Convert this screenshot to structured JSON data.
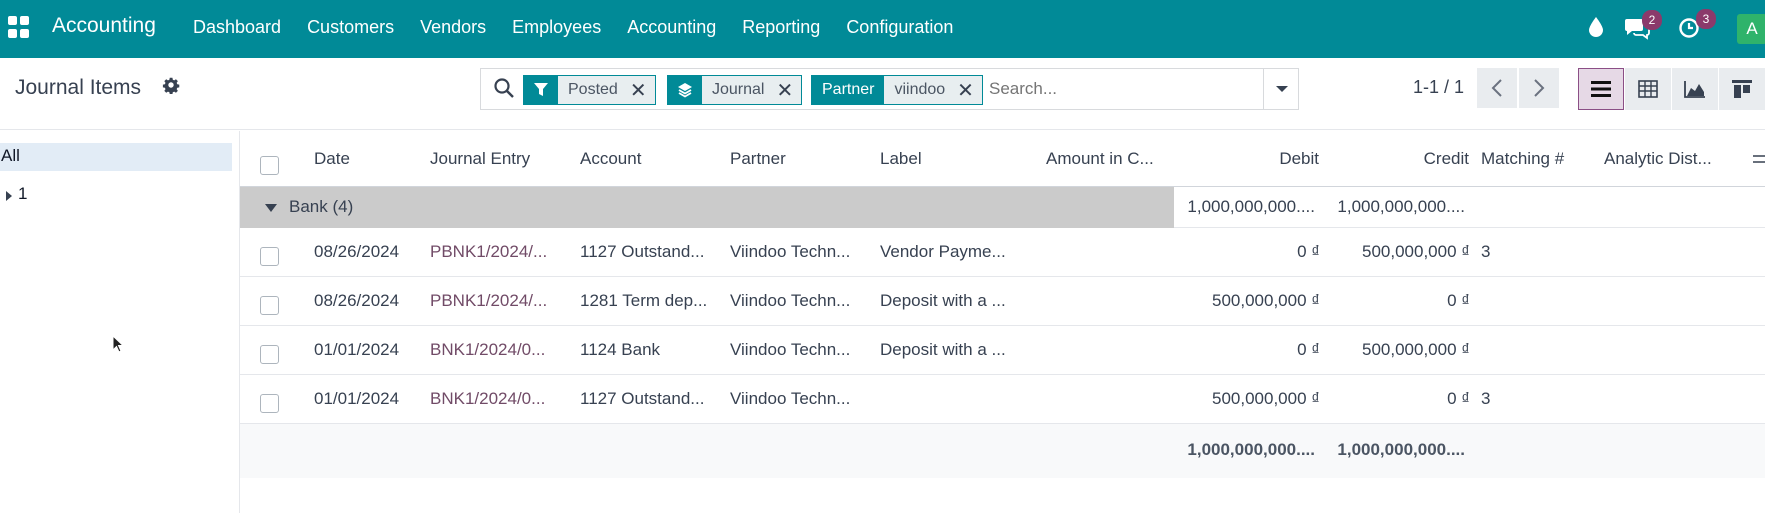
{
  "topbar": {
    "app_name": "Accounting",
    "nav": [
      "Dashboard",
      "Customers",
      "Vendors",
      "Employees",
      "Accounting",
      "Reporting",
      "Configuration"
    ],
    "messages_count": "2",
    "activities_count": "3",
    "avatar_letter": "A",
    "bg_color": "#018a97"
  },
  "control_panel": {
    "title": "Journal Items",
    "facets": [
      {
        "key_icon": "filter-icon",
        "value": "Posted"
      },
      {
        "key_icon": "layers-icon",
        "value": "Journal"
      },
      {
        "key": "Partner",
        "value": "viindoo"
      }
    ],
    "search_placeholder": "Search...",
    "pager": "1-1 / 1"
  },
  "sidebar": {
    "items": [
      "All",
      "1"
    ]
  },
  "table": {
    "columns": [
      "Date",
      "Journal Entry",
      "Account",
      "Partner",
      "Label",
      "Amount in C...",
      "Debit",
      "Credit",
      "Matching #",
      "Analytic Dist..."
    ],
    "group": {
      "label": "Bank (4)",
      "debit": "1,000,000,000....",
      "credit": "1,000,000,000...."
    },
    "rows": [
      {
        "date": "08/26/2024",
        "entry": "PBNK1/2024/...",
        "account": "1127 Outstand...",
        "partner": "Viindoo Techn...",
        "label": "Vendor Payme...",
        "debit": "0 ₫",
        "credit": "500,000,000 ₫",
        "matching": "3"
      },
      {
        "date": "08/26/2024",
        "entry": "PBNK1/2024/...",
        "account": "1281 Term dep...",
        "partner": "Viindoo Techn...",
        "label": "Deposit with a ...",
        "debit": "500,000,000 ₫",
        "credit": "0 ₫",
        "matching": ""
      },
      {
        "date": "01/01/2024",
        "entry": "BNK1/2024/0...",
        "account": "1124 Bank",
        "partner": "Viindoo Techn...",
        "label": "Deposit with a ...",
        "debit": "0 ₫",
        "credit": "500,000,000 ₫",
        "matching": ""
      },
      {
        "date": "01/01/2024",
        "entry": "BNK1/2024/0...",
        "account": "1127 Outstand...",
        "partner": "Viindoo Techn...",
        "label": "",
        "debit": "500,000,000 ₫",
        "credit": "0 ₫",
        "matching": "3"
      }
    ],
    "totals": {
      "debit": "1,000,000,000....",
      "credit": "1,000,000,000...."
    }
  }
}
